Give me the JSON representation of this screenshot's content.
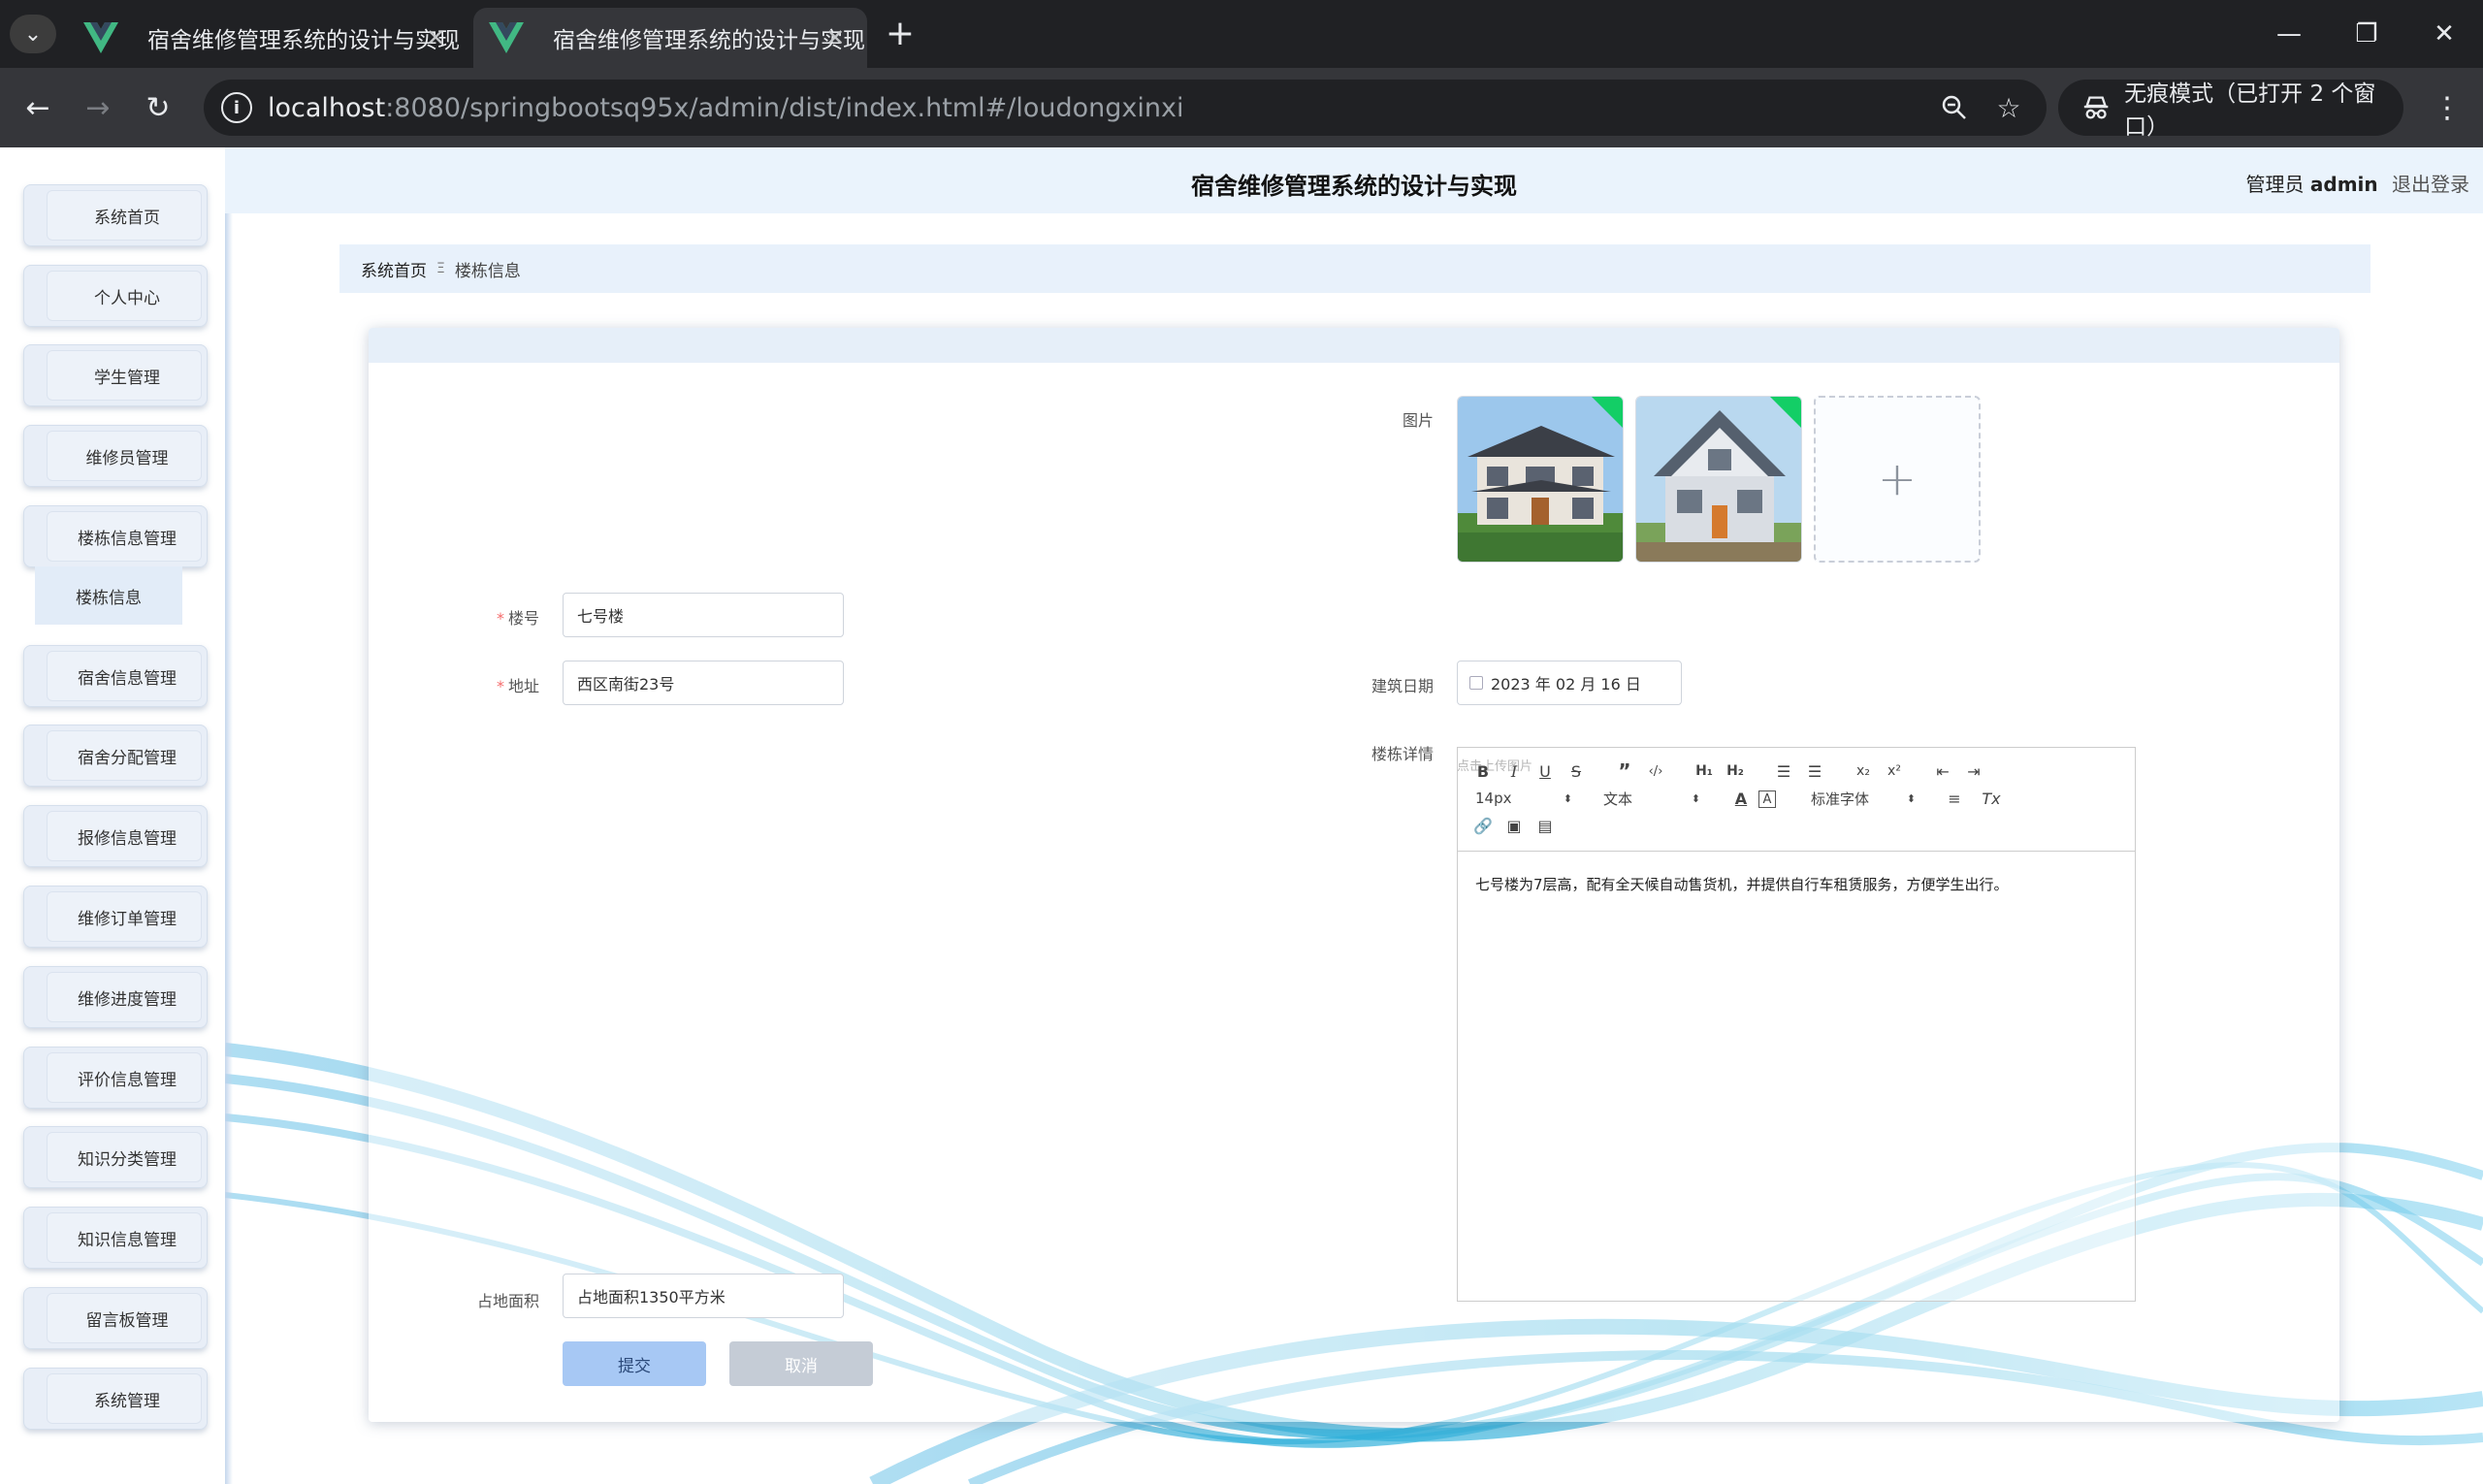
{
  "browser": {
    "tabs": [
      {
        "title": "宿舍维修管理系统的设计与实现",
        "active": false
      },
      {
        "title": "宿舍维修管理系统的设计与实现",
        "active": true
      }
    ],
    "url_host": "localhost",
    "url_rest": ":8080/springbootsq95x/admin/dist/index.html#/loudongxinxi",
    "incognito_label": "无痕模式（已打开 2 个窗口）"
  },
  "header": {
    "title": "宿舍维修管理系统的设计与实现",
    "role_label": "管理员",
    "username": "admin",
    "logout_label": "退出登录"
  },
  "sidebar": {
    "items": [
      {
        "label": "系统首页"
      },
      {
        "label": "个人中心"
      },
      {
        "label": "学生管理"
      },
      {
        "label": "维修员管理"
      },
      {
        "label": "楼栋信息管理"
      },
      {
        "label": "宿舍信息管理"
      },
      {
        "label": "宿舍分配管理"
      },
      {
        "label": "报修信息管理"
      },
      {
        "label": "维修订单管理"
      },
      {
        "label": "维修进度管理"
      },
      {
        "label": "评价信息管理"
      },
      {
        "label": "知识分类管理"
      },
      {
        "label": "知识信息管理"
      },
      {
        "label": "留言板管理"
      },
      {
        "label": "系统管理"
      }
    ],
    "active_sub": "楼栋信息"
  },
  "breadcrumb": {
    "home": "系统首页",
    "separator": "Ξ",
    "current": "楼栋信息"
  },
  "form": {
    "building_no": {
      "label": "楼号",
      "value": "七号楼"
    },
    "address": {
      "label": "地址",
      "value": "西区南街23号"
    },
    "area": {
      "label": "占地面积",
      "value": "占地面积1350平方米"
    },
    "picture": {
      "label": "图片",
      "hint": "点击上传图片"
    },
    "build_date": {
      "label": "建筑日期",
      "value": "2023 年 02 月 16 日"
    },
    "detail": {
      "label": "楼栋详情",
      "size_picker": "14px",
      "header_picker": "文本",
      "font_picker": "标准字体",
      "content": "七号楼为7层高，配有全天候自动售货机，并提供自行车租赁服务，方便学生出行。"
    },
    "submit_label": "提交",
    "cancel_label": "取消"
  },
  "colors": {
    "accent_light": "#eaf3fc",
    "submit_bg": "#a7c8f4",
    "cancel_bg": "#c5ccd6",
    "upload_success": "#13ce66",
    "required": "#f56c6c"
  }
}
